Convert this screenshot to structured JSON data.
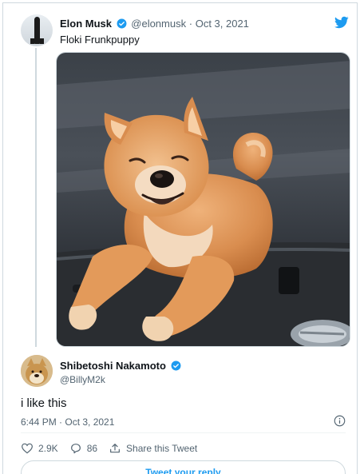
{
  "tweet": {
    "author_name": "Elon Musk",
    "author_handle": "@elonmusk",
    "separator": "·",
    "date": "Oct 3, 2021",
    "text": "Floki Frunkpuppy",
    "media_description": "photo-shiba-inu-in-car-trunk"
  },
  "reply": {
    "author_name": "Shibetoshi Nakamoto",
    "author_handle": "@BillyM2k",
    "text": "i like this",
    "timestamp": "6:44 PM · Oct 3, 2021",
    "likes": "2.9K",
    "replies": "86",
    "share_label": "Share this Tweet",
    "reply_button_label": "Tweet your reply"
  },
  "colors": {
    "brand_blue": "#1d9bf0",
    "text_primary": "#0f1419",
    "text_muted": "#536471",
    "border": "#cfd9de"
  },
  "icons": {
    "brand": "twitter-bird-icon",
    "verified": "verified-badge-icon",
    "info": "info-icon",
    "like": "heart-icon",
    "reply": "reply-bubble-icon",
    "share": "share-icon"
  }
}
